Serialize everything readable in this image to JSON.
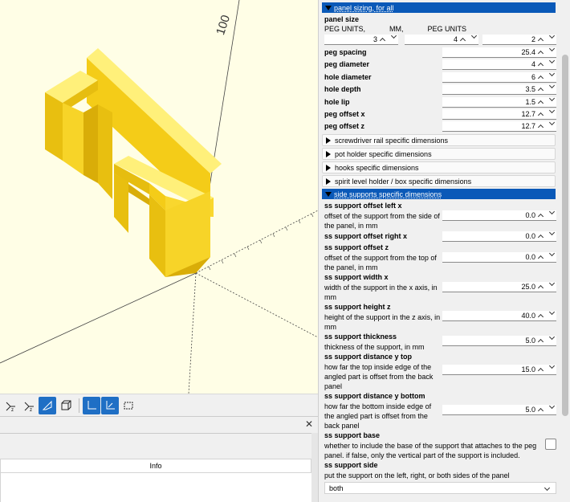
{
  "colors": {
    "accent": "#0a59b8",
    "model": "#f9d72e",
    "viewport_bg": "#fffee6"
  },
  "viewport": {
    "axis_label": "100"
  },
  "toolbar": {
    "icons": [
      "view-xz-icon",
      "view-yz-icon",
      "perspective-icon",
      "orthogonal-icon",
      "axes-icon",
      "scale-markers-icon",
      "edges-icon"
    ]
  },
  "console": {
    "close_glyph": "✕",
    "column_header": "Info"
  },
  "customizer": {
    "group_panel_sizing": "panel sizing, for all",
    "panel_size": {
      "label": "panel size",
      "units_line": "PEG UNITS,            MM,            PEG UNITS",
      "values": [
        "3",
        "4",
        "2"
      ]
    },
    "params": [
      {
        "label": "peg spacing",
        "value": "25.4"
      },
      {
        "label": "peg diameter",
        "value": "4"
      },
      {
        "label": "hole diameter",
        "value": "6"
      },
      {
        "label": "hole depth",
        "value": "3.5"
      },
      {
        "label": "hole lip",
        "value": "1.5"
      },
      {
        "label": "peg offset x",
        "value": "12.7"
      },
      {
        "label": "peg offset z",
        "value": "12.7"
      }
    ],
    "collapsed_groups": [
      "screwdriver rail specific dimensions",
      "pot holder specific dimensions",
      "hooks specific dimensions",
      "spirit level holder / box specific dimensions"
    ],
    "group_side_supports": "side supports specific dimensions",
    "ss_params": [
      {
        "label": "ss support offset left x",
        "desc": "offset of the support from the side of the panel, in mm",
        "value": "0.0"
      },
      {
        "label": "ss support offset right x",
        "desc": "",
        "value": "0.0"
      },
      {
        "label": "ss support offset z",
        "desc": "offset of the support from the top of the panel, in mm",
        "value": "0.0"
      },
      {
        "label": "ss support width x",
        "desc": "width of the support in the x axis, in mm",
        "value": "25.0"
      },
      {
        "label": "ss support height z",
        "desc": "height of the support in the z axis, in mm",
        "value": "40.0"
      },
      {
        "label": "ss support thickness",
        "desc": "thickness of the support, in mm",
        "value": "5.0"
      },
      {
        "label": "ss support distance y top",
        "desc": "how far the top inside edge of the angled part is offset from the back panel",
        "value": "15.0"
      },
      {
        "label": "ss support distance y bottom",
        "desc": "how far the bottom inside edge of the angled part is offset from the back panel",
        "value": "5.0"
      }
    ],
    "ss_base": {
      "label": "ss support base",
      "desc": "whether to include the base of the support that attaches to the peg panel. if false, only the vertical part of the support is included."
    },
    "ss_side": {
      "label": "ss support side",
      "desc": "put the support on the left, right, or both sides of the panel",
      "value": "both"
    }
  }
}
